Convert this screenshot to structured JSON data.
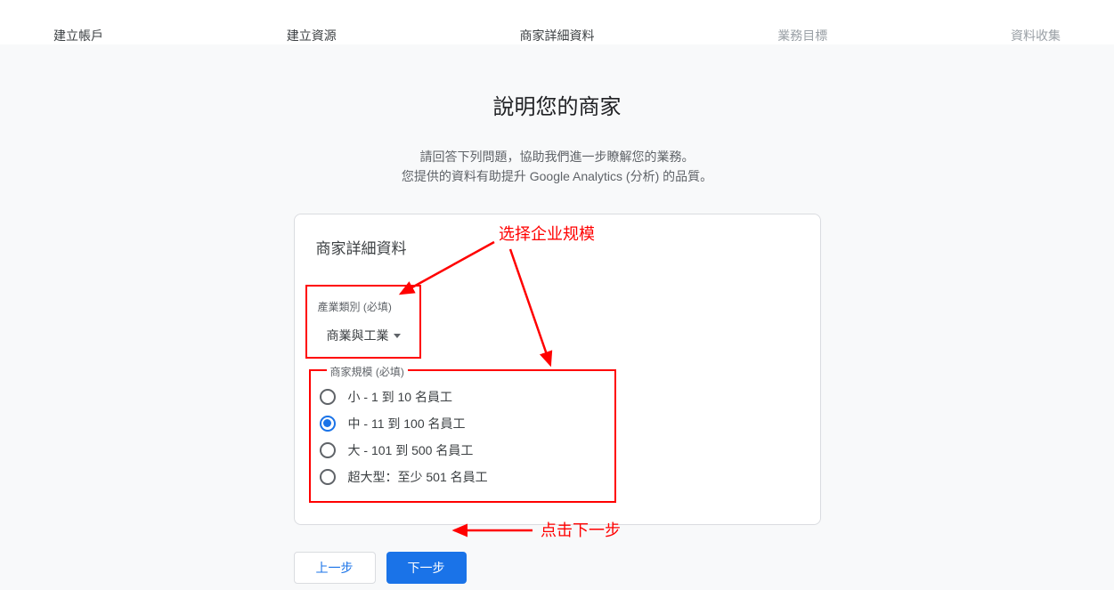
{
  "stepper": {
    "items": [
      {
        "label": "建立帳戶",
        "disabled": false
      },
      {
        "label": "建立資源",
        "disabled": false
      },
      {
        "label": "商家詳細資料",
        "disabled": false
      },
      {
        "label": "業務目標",
        "disabled": true
      },
      {
        "label": "資料收集",
        "disabled": true
      }
    ]
  },
  "page": {
    "title": "說明您的商家",
    "subtitle_line1": "請回答下列問題，協助我們進一步瞭解您的業務。",
    "subtitle_line2": "您提供的資料有助提升 Google Analytics (分析) 的品質。"
  },
  "card": {
    "title": "商家詳細資料",
    "category": {
      "label": "產業類別 (必填)",
      "selected": "商業與工業"
    },
    "size": {
      "label": "商家規模 (必填)",
      "options": [
        {
          "label": "小 - 1 到 10 名員工",
          "selected": false
        },
        {
          "label": "中 - 11 到 100 名員工",
          "selected": true
        },
        {
          "label": "大 - 101 到 500 名員工",
          "selected": false
        },
        {
          "label": "超大型：至少 501 名員工",
          "selected": false
        }
      ]
    }
  },
  "buttons": {
    "prev": "上一步",
    "next": "下一步"
  },
  "annotations": {
    "select_size": "选择企业规模",
    "click_next": "点击下一步"
  }
}
